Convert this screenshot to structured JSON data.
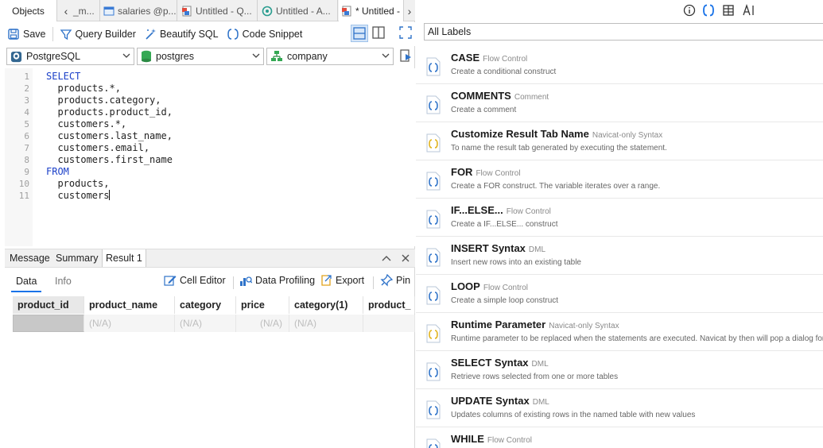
{
  "tabs": {
    "objects": "Objects",
    "tab1": "_m...",
    "tab2": "salaries @p...",
    "tab3": "Untitled - Q...",
    "tab4": "Untitled - A...",
    "tab5": "* Untitled -"
  },
  "toolbar": {
    "save": "Save",
    "query_builder": "Query Builder",
    "beautify": "Beautify SQL",
    "code_snippet": "Code Snippet"
  },
  "selectors": {
    "connection": "PostgreSQL",
    "database": "postgres",
    "schema": "company"
  },
  "editor": {
    "line_numbers": [
      "1",
      "2",
      "3",
      "4",
      "5",
      "6",
      "7",
      "8",
      "9",
      "10",
      "11"
    ],
    "lines": [
      "SELECT",
      "  products.*,",
      "  products.category,",
      "  products.product_id,",
      "  customers.*,",
      "  customers.last_name,",
      "  customers.email,",
      "  customers.first_name",
      "FROM",
      "  products,",
      "  customers"
    ]
  },
  "result_tabs": {
    "message": "Message",
    "summary": "Summary",
    "result": "Result 1"
  },
  "result_subtabs": {
    "data": "Data",
    "info": "Info",
    "cell_editor": "Cell Editor",
    "data_profiling": "Data Profiling",
    "export": "Export",
    "pin": "Pin"
  },
  "grid": {
    "columns": [
      "product_id",
      "product_name",
      "category",
      "price",
      "category(1)",
      "product_"
    ],
    "row": [
      "",
      "(N/A)",
      "(N/A)",
      "(N/A)",
      "(N/A)",
      ""
    ]
  },
  "right": {
    "filter": "All Labels",
    "snippets": [
      {
        "title": "CASE",
        "tag": "Flow Control",
        "desc": "Create a conditional construct",
        "icon": "code-brackets-blue"
      },
      {
        "title": "COMMENTS",
        "tag": "Comment",
        "desc": "Create a comment",
        "icon": "code-brackets-blue"
      },
      {
        "title": "Customize Result Tab Name",
        "tag": "Navicat-only Syntax",
        "desc": "To name the result tab generated by executing the statement.",
        "icon": "code-brackets-yellow"
      },
      {
        "title": "FOR",
        "tag": "Flow Control",
        "desc": "Create a FOR construct. The variable iterates over a range.",
        "icon": "code-brackets-blue"
      },
      {
        "title": "IF...ELSE...",
        "tag": "Flow Control",
        "desc": "Create a IF...ELSE... construct",
        "icon": "code-brackets-blue"
      },
      {
        "title": "INSERT Syntax",
        "tag": "DML",
        "desc": "Insert new rows into an existing table",
        "icon": "code-brackets-blue"
      },
      {
        "title": "LOOP",
        "tag": "Flow Control",
        "desc": "Create a simple loop construct",
        "icon": "code-brackets-blue"
      },
      {
        "title": "Runtime Parameter",
        "tag": "Navicat-only Syntax",
        "desc": "Runtime parameter to be replaced when the statements are executed. Navicat by then will pop a dialog for you to input v",
        "icon": "code-brackets-yellow"
      },
      {
        "title": "SELECT Syntax",
        "tag": "DML",
        "desc": "Retrieve rows selected from one or more tables",
        "icon": "code-brackets-blue"
      },
      {
        "title": "UPDATE Syntax",
        "tag": "DML",
        "desc": "Updates columns of existing rows in the named table with new values",
        "icon": "code-brackets-blue"
      },
      {
        "title": "WHILE",
        "tag": "Flow Control",
        "desc": "",
        "icon": "code-brackets-blue"
      }
    ]
  },
  "colors": {
    "accent": "#1a73e8",
    "keyword": "#1a3fc8",
    "snippet_icon_blue": "#2f73c9",
    "snippet_icon_yellow": "#e0b21b"
  }
}
